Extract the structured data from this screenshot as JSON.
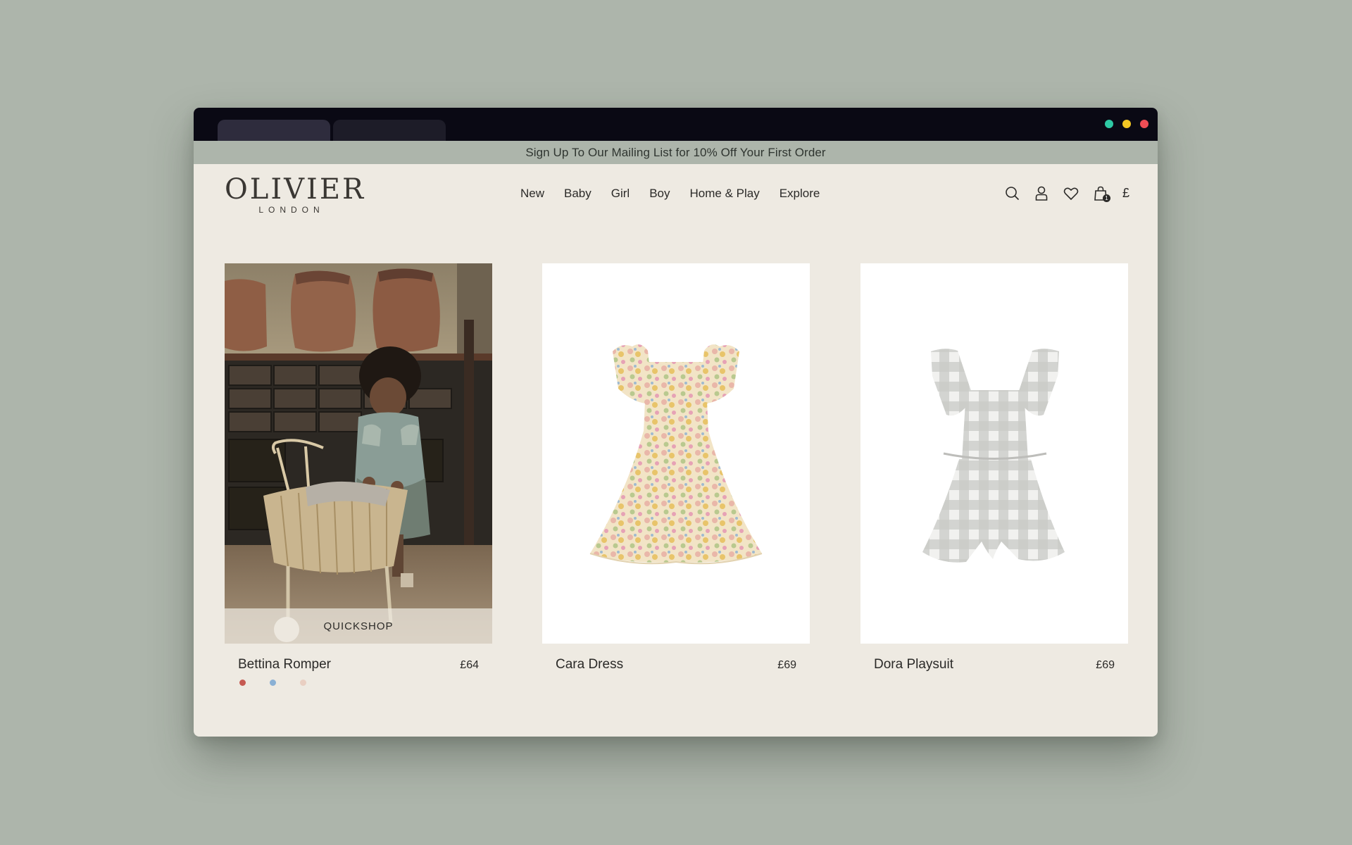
{
  "window": {
    "dots": [
      {
        "name": "dot-green",
        "color": "#2ec9a4"
      },
      {
        "name": "dot-yellow",
        "color": "#f3c724"
      },
      {
        "name": "dot-red",
        "color": "#ef4d55"
      }
    ]
  },
  "promo": {
    "text": "Sign Up To Our Mailing List for 10% Off Your First Order"
  },
  "header": {
    "logo_main": "OLIVIER",
    "logo_sub": "LONDON",
    "nav": [
      "New",
      "Baby",
      "Girl",
      "Boy",
      "Home & Play",
      "Explore"
    ],
    "icons": [
      "search-icon",
      "account-icon",
      "heart-icon",
      "bag-icon"
    ],
    "bag_count": "1",
    "currency": "£"
  },
  "products": [
    {
      "name": "Bettina Romper",
      "price": "£64",
      "quickshop": "QUICKSHOP",
      "swatches": [
        "#c65a52",
        "#8ab0d4",
        "#e9cfc2"
      ]
    },
    {
      "name": "Cara Dress",
      "price": "£69"
    },
    {
      "name": "Dora Playsuit",
      "price": "£69"
    }
  ],
  "colors": {
    "page_bg": "#adb5ab",
    "site_bg": "#eeeae2",
    "titlebar": "#0a0914",
    "text": "#2b2a28"
  }
}
